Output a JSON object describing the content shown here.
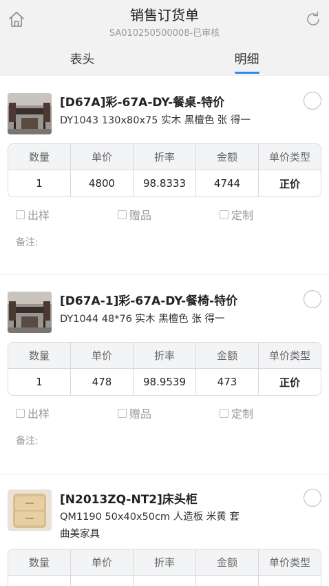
{
  "header": {
    "title": "销售订货单",
    "subtitle": "SA010250500008-已审核",
    "tabs": [
      {
        "label": "表头",
        "active": false
      },
      {
        "label": "明细",
        "active": true
      }
    ],
    "accent_color": "#2a8cf0",
    "left_icon": "home-icon",
    "right_icon": "refresh-icon"
  },
  "columns": [
    "数量",
    "单价",
    "折率",
    "金额",
    "单价类型"
  ],
  "options": [
    "出样",
    "赠品",
    "定制"
  ],
  "remark_label": "备注:",
  "items": [
    {
      "name": "[D67A]彩-67A-DY-餐桌-特价",
      "spec": "DY1043   130x80x75   实木   黑檀色   张   得一",
      "brand": "",
      "image": "dining-table-thumbnail",
      "values": [
        "1",
        "4800",
        "98.8333",
        "4744",
        "正价"
      ]
    },
    {
      "name": "[D67A-1]彩-67A-DY-餐椅-特价",
      "spec": "DY1044   48*76   实木   黑檀色   张   得一",
      "brand": "",
      "image": "dining-chair-thumbnail",
      "values": [
        "1",
        "478",
        "98.9539",
        "473",
        "正价"
      ]
    },
    {
      "name": "[N2013ZQ-NT2]床头柜",
      "spec": "QM1190   50x40x50cm   人造板   米黄   套",
      "brand": "曲美家具",
      "image": "nightstand-thumbnail",
      "values": [
        "",
        "",
        "",
        "",
        ""
      ]
    }
  ]
}
